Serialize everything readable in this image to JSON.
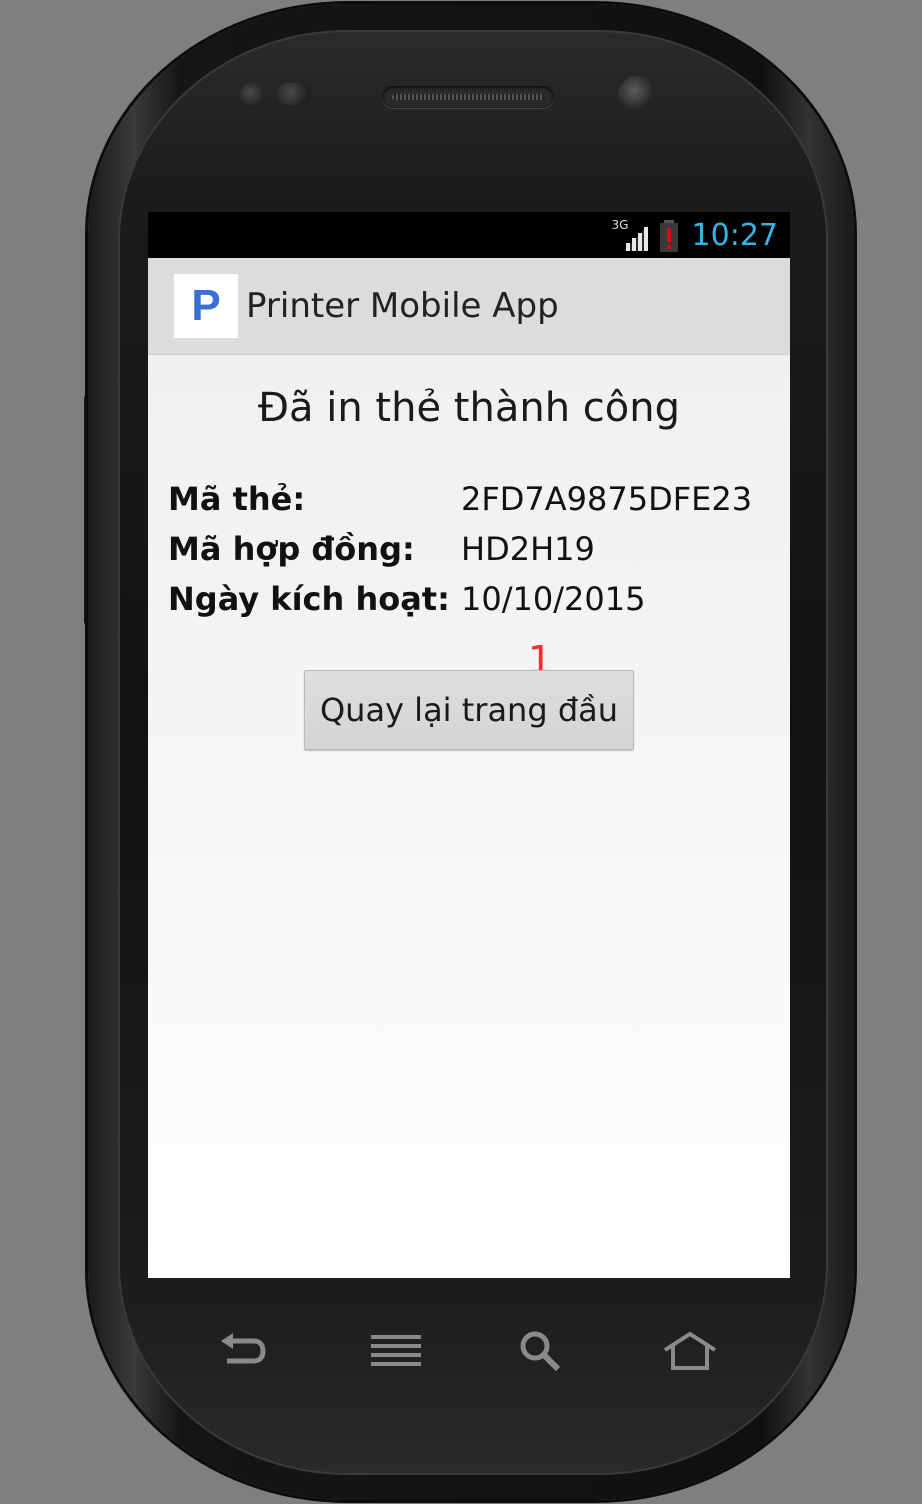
{
  "statusbar": {
    "network_label": "3G",
    "time": "10:27"
  },
  "app": {
    "logo_letter": "P",
    "title": "Printer Mobile App"
  },
  "main": {
    "heading": "Đã in thẻ thành công",
    "details": [
      {
        "label": "Mã thẻ:",
        "value": "2FD7A9875DFE23"
      },
      {
        "label": "Mã hợp đồng:",
        "value": "HD2H19"
      },
      {
        "label": "Ngày kích hoạt:",
        "value": "10/10/2015"
      }
    ],
    "marker": "1",
    "back_button_label": "Quay lại trang đầu"
  },
  "navkeys": [
    "back-icon",
    "menu-icon",
    "search-icon",
    "home-icon"
  ],
  "colors": {
    "status_time": "#33b5e5",
    "logo": "#3b6fd6",
    "marker": "#ff2a2a",
    "battery_alert": "#d01010"
  }
}
